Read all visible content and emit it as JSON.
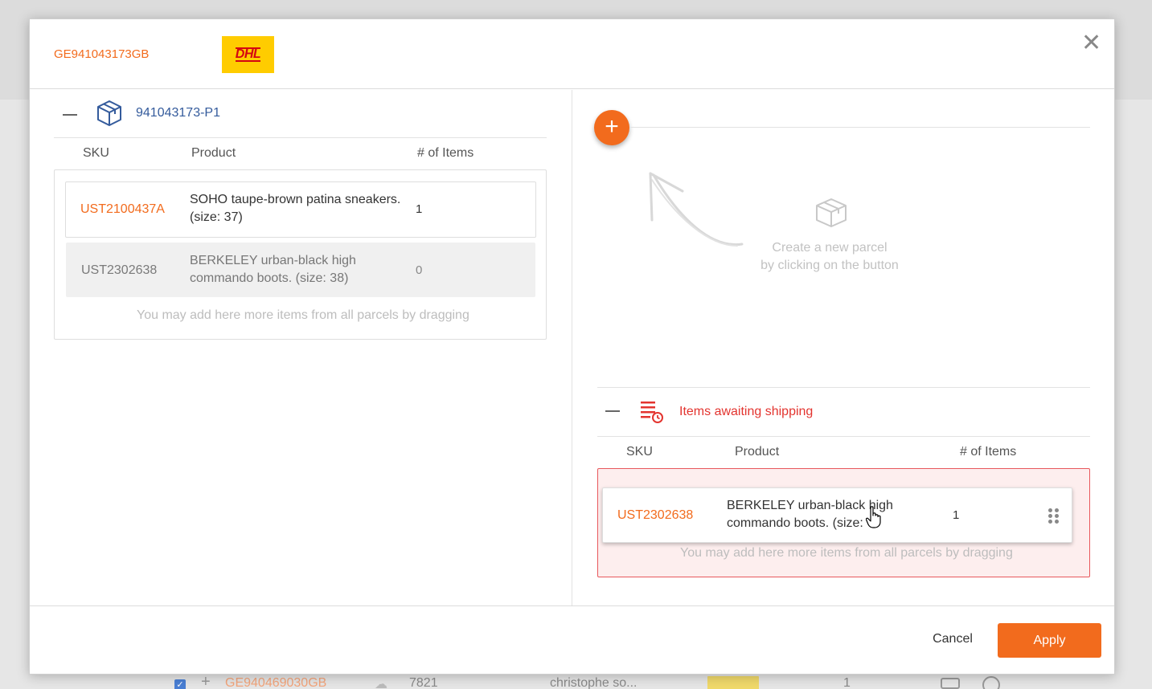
{
  "background_row": {
    "tracking": "GE940469030GB",
    "number": "7821",
    "customer": "christophe so...",
    "quantity": "1"
  },
  "modal": {
    "tracking_number": "GE941043173GB",
    "carrier_logo_text": "DHL",
    "close_glyph": "✕"
  },
  "left_parcel": {
    "collapse_glyph": "—",
    "parcel_id": "941043173-P1",
    "columns": {
      "sku": "SKU",
      "product": "Product",
      "items": "# of Items"
    },
    "items": [
      {
        "sku": "UST2100437A",
        "product": "SOHO taupe-brown patina sneakers.",
        "product_line2": "(size: 37)",
        "qty": "1"
      },
      {
        "sku": "UST2302638",
        "product": "BERKELEY urban-black high",
        "product_line2": "commando boots. (size: 38)",
        "qty": "0"
      }
    ],
    "drop_hint": "You may add here more items from all parcels by dragging"
  },
  "new_parcel": {
    "add_glyph": "+",
    "empty_line1": "Create a new parcel",
    "empty_line2": "by clicking on the button"
  },
  "awaiting": {
    "title": "Items awaiting shipping",
    "columns": {
      "sku": "SKU",
      "product": "Product",
      "items": "# of Items"
    },
    "items": [
      {
        "sku": "UST2302638",
        "product": "BERKELEY urban-black high",
        "product_line2": "commando boots. (size: ",
        "qty": "1"
      }
    ],
    "drop_hint": "You may add here more items from all parcels by dragging"
  },
  "footer": {
    "cancel_label": "Cancel",
    "apply_label": "Apply"
  },
  "colors": {
    "accent": "#f26b1d",
    "link_blue": "#345b9c",
    "danger": "#e3342f",
    "dhl_yellow": "#ffcc00",
    "dhl_red": "#d40511"
  }
}
